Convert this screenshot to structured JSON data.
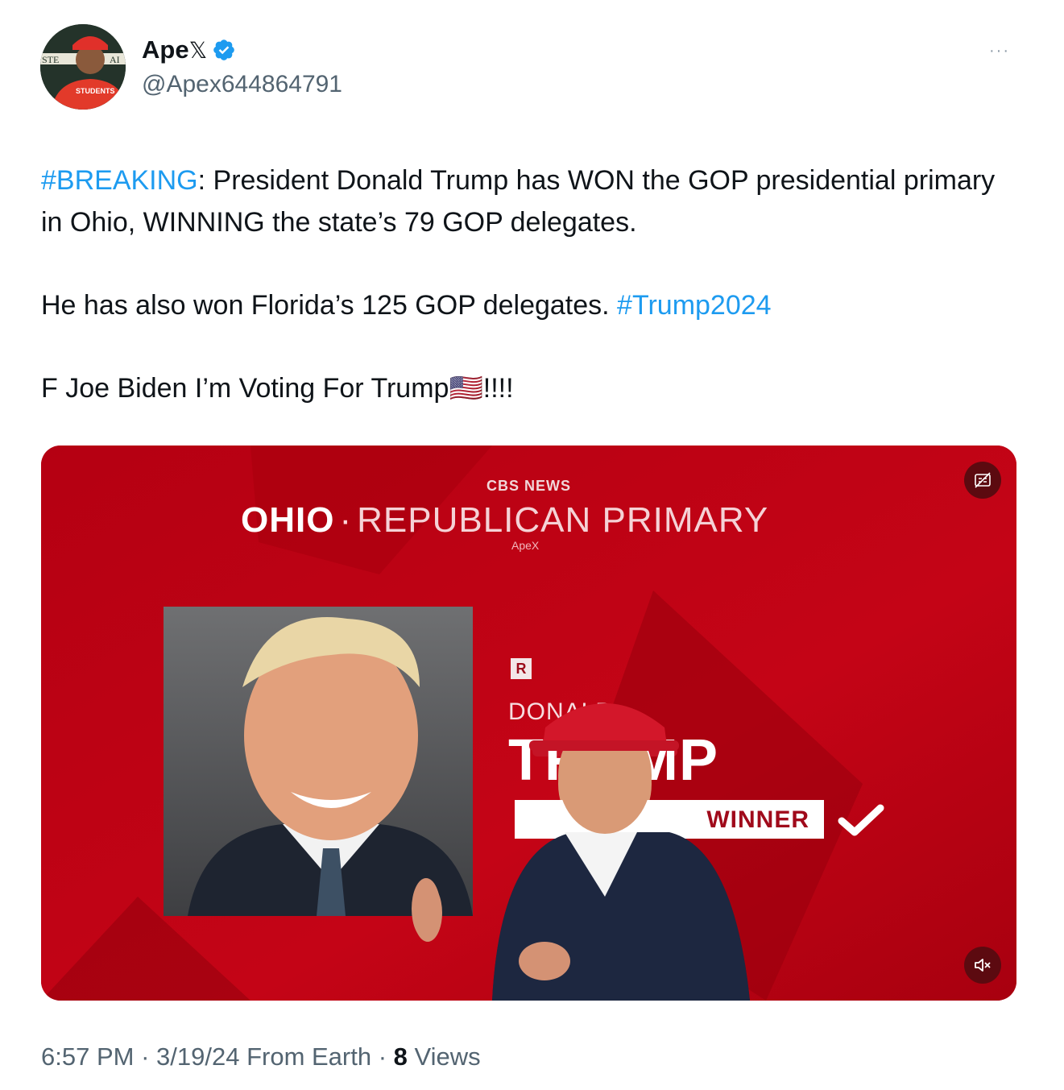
{
  "author": {
    "display_name": "Ape",
    "x_badge": "𝕏",
    "handle": "@Apex644864791",
    "avatar_icon": "avatar-photo",
    "avatar_text": {
      "top": "STE",
      "right": "AI",
      "shirt": "STUDENTS"
    }
  },
  "more_icon": "···",
  "tweet": {
    "line1_tag": "#BREAKING",
    "line1_text": ": President Donald Trump has WON the GOP presidential primary in Ohio, WINNING the state’s 79 GOP delegates.",
    "line2_text": "He has also won Florida’s 125 GOP delegates. ",
    "line2_tag": "#Trump2024",
    "line3_text": "F Joe Biden I’m Voting For Trump",
    "line3_flag": "🇺🇸",
    "line3_end": "!!!!"
  },
  "media": {
    "news_logo": "CBS NEWS",
    "state": "OHIO",
    "separator": "·",
    "race": "REPUBLICAN PRIMARY",
    "watermark": "ApeX",
    "party_badge": "R",
    "candidate_first": "DONALD",
    "candidate_last": "TRUMP",
    "status": "PROJECTED WINNER",
    "status_visible": "WINNER",
    "cc_icon": "captions-off-icon",
    "mute_icon": "volume-muted-icon"
  },
  "footer": {
    "time": "6:57 PM",
    "dot1": " · ",
    "date": "3/19/24",
    "source": " From Earth",
    "dot2": " · ",
    "views_count": "8",
    "views_label": " Views"
  },
  "colors": {
    "link": "#1d9bf0",
    "text": "#0f1419",
    "muted": "#536471",
    "verified": "#1d9bf0",
    "media_red": "#b30012"
  }
}
